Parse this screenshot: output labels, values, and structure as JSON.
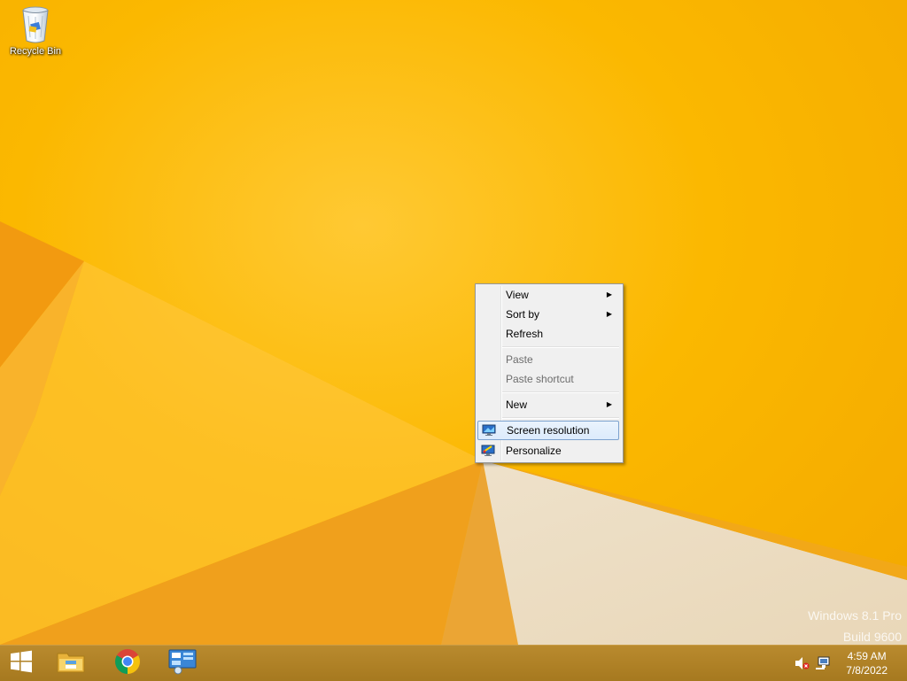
{
  "desktop": {
    "icons": [
      {
        "label": "Recycle Bin",
        "icon": "recycle-bin-icon"
      }
    ],
    "watermark": {
      "line1": "Windows 8.1 Pro",
      "line2": "Build 9600"
    }
  },
  "context_menu": {
    "items": [
      {
        "label": "View",
        "submenu": true,
        "enabled": true
      },
      {
        "label": "Sort by",
        "submenu": true,
        "enabled": true
      },
      {
        "label": "Refresh",
        "submenu": false,
        "enabled": true
      },
      {
        "label": "Paste",
        "submenu": false,
        "enabled": false
      },
      {
        "label": "Paste shortcut",
        "submenu": false,
        "enabled": false
      },
      {
        "label": "New",
        "submenu": true,
        "enabled": true
      },
      {
        "label": "Screen resolution",
        "submenu": false,
        "enabled": true,
        "highlighted": true,
        "icon": "display-icon"
      },
      {
        "label": "Personalize",
        "submenu": false,
        "enabled": true,
        "icon": "personalize-icon"
      }
    ],
    "submenu_arrow": "▶"
  },
  "taskbar": {
    "start_icon": "windows-logo-icon",
    "pinned": [
      "file-explorer-icon",
      "chrome-icon",
      "control-panel-icon"
    ],
    "tray": [
      "volume-muted-icon",
      "network-icon"
    ],
    "clock": {
      "time": "4:59 AM",
      "date": "7/8/2022"
    }
  },
  "colors": {
    "wallpaper": "#f8b400",
    "taskbar": "#a6791f",
    "menu_bg": "#f0f0f0",
    "menu_highlight_border": "#7da2ce"
  }
}
